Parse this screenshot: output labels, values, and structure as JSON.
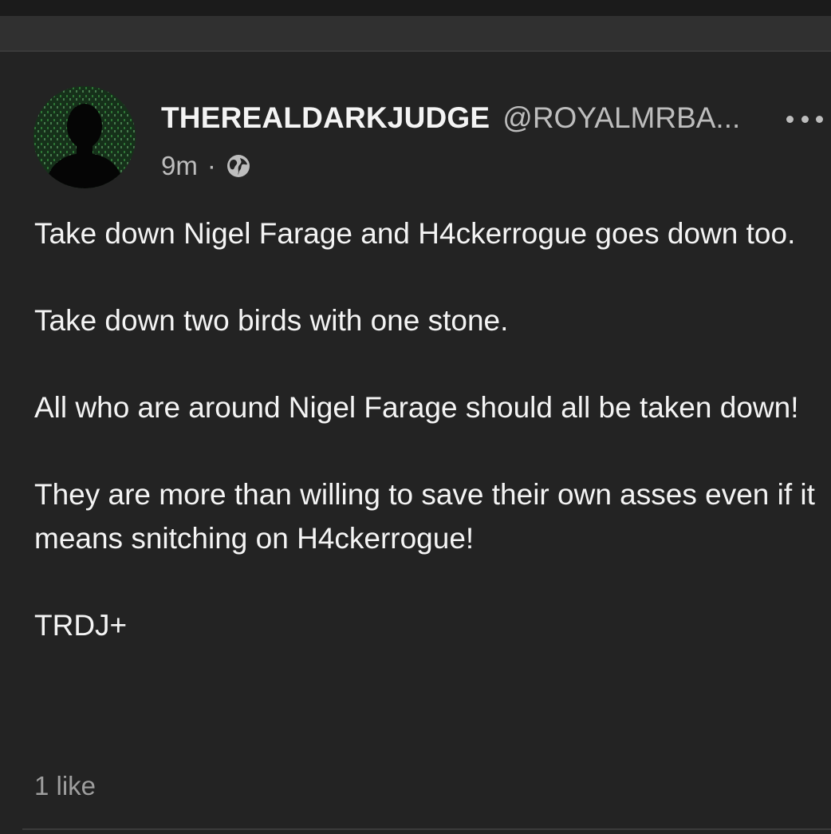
{
  "post": {
    "display_name": "THEREALDARKJUDGE",
    "handle": "@ROYALMRBA...",
    "time": "9m",
    "separator": "·",
    "paragraphs": [
      "Take down Nigel Farage and H4ckerrogue goes down too.",
      "Take down two birds with one stone.",
      "All who are around Nigel Farage should all be taken down!",
      "They are more than willing to save their own asses even if it means snitching on H4ckerrogue!",
      "TRDJ+"
    ],
    "likes": "1 like"
  },
  "icons": {
    "more": "more-horizontal-icon",
    "visibility": "globe-icon"
  },
  "colors": {
    "background": "#232323",
    "header": "#303030",
    "text": "#f4f4f4",
    "muted": "#bdbdbd",
    "avatar_matrix_green": "#3fae4a"
  }
}
